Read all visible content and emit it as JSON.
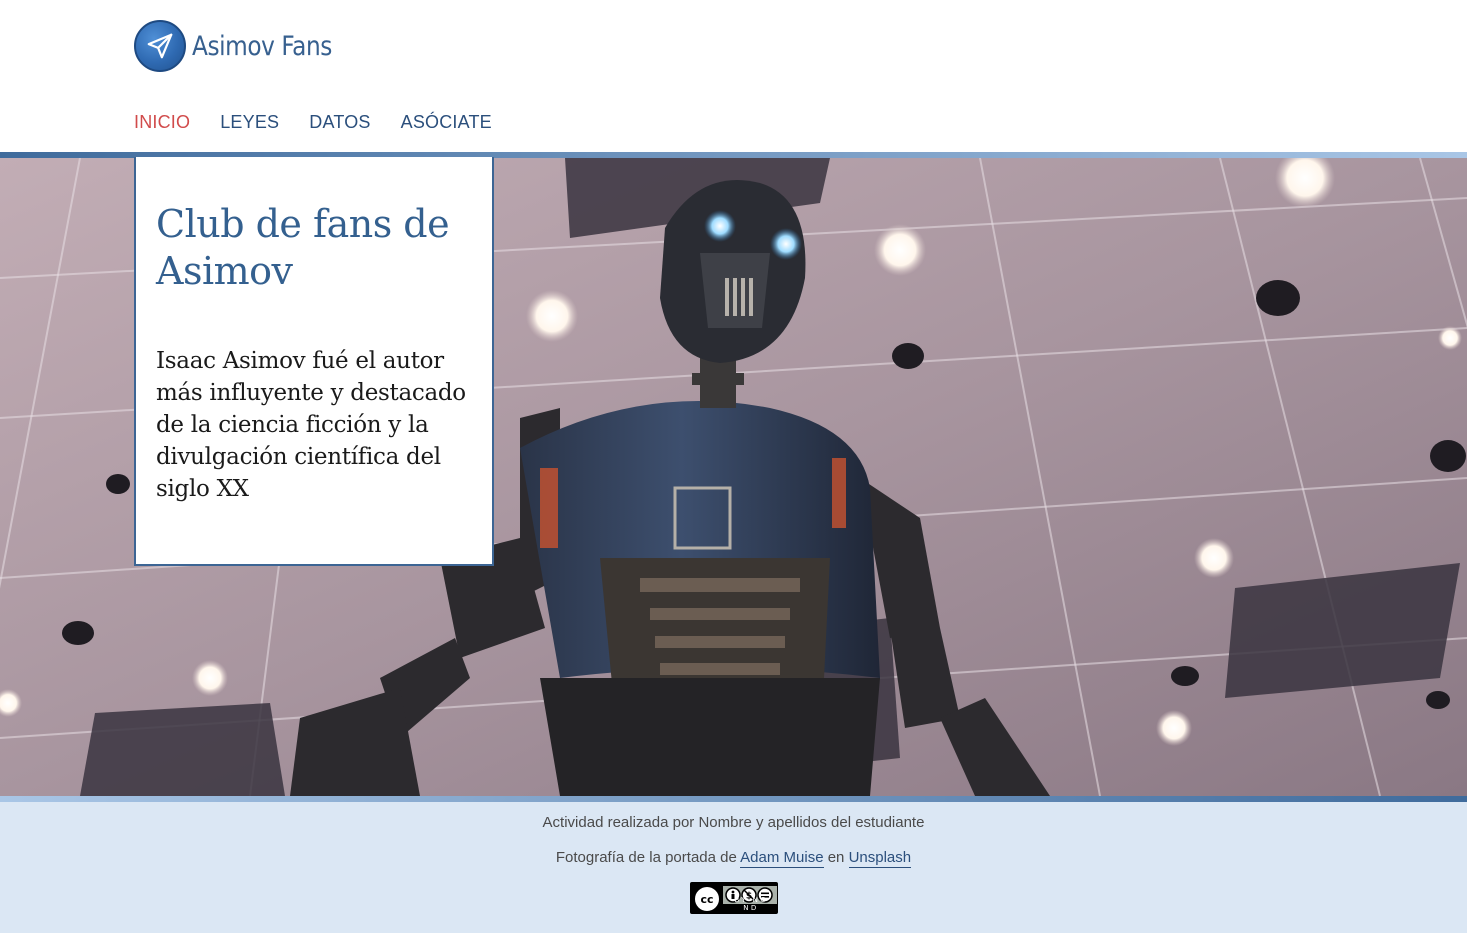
{
  "header": {
    "brand_name": "Asimov Fans",
    "logo_icon": "paper-plane-icon",
    "nav": [
      {
        "label": "INICIO",
        "active": true
      },
      {
        "label": "LEYES",
        "active": false
      },
      {
        "label": "DATOS",
        "active": false
      },
      {
        "label": "ASÓCIATE",
        "active": false
      }
    ]
  },
  "hero": {
    "title": "Club de fans de Asimov",
    "text": "Isaac Asimov fué el autor más influyente y destacado de la ciencia ficción y la divulgación científica del siglo XX",
    "image": "robot-photo"
  },
  "footer": {
    "credit_line": "Actividad realizada por Nombre y apellidos del estudiante",
    "photo_prefix": "Fotografía de la portada de",
    "photo_author": "Adam Muise",
    "photo_connector": "en",
    "photo_site": "Unsplash",
    "license_icon": "cc-by-nc-nd-icon",
    "license_labels": "BY NC ND"
  },
  "colors": {
    "primary": "#34608f",
    "active_nav": "#d14b4b",
    "footer_bg": "#dbe7f4"
  }
}
